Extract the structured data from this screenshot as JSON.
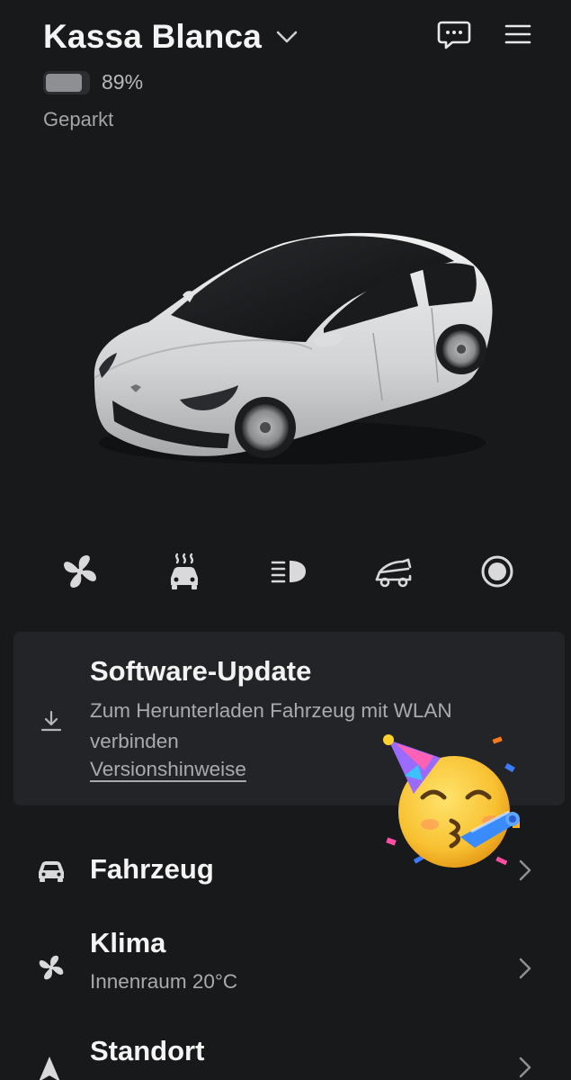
{
  "header": {
    "car_name": "Kassa Blanca",
    "battery_percent_label": "89%",
    "battery_level": 0.89,
    "status": "Geparkt"
  },
  "quick_controls": [
    "fan-icon",
    "seat-heater-icon",
    "headlights-icon",
    "trunk-icon",
    "record-icon"
  ],
  "software_update": {
    "title": "Software-Update",
    "description": "Zum Herunterladen Fahrzeug mit WLAN verbinden",
    "link": "Versionshinweise"
  },
  "list": {
    "vehicle": {
      "title": "Fahrzeug"
    },
    "climate": {
      "title": "Klima",
      "subtitle": "Innenraum 20°C"
    },
    "location": {
      "title": "Standort"
    }
  },
  "colors": {
    "background": "#18191b",
    "card": "#232427",
    "text_primary": "#f4f4f4",
    "text_secondary": "#a9aaad"
  }
}
